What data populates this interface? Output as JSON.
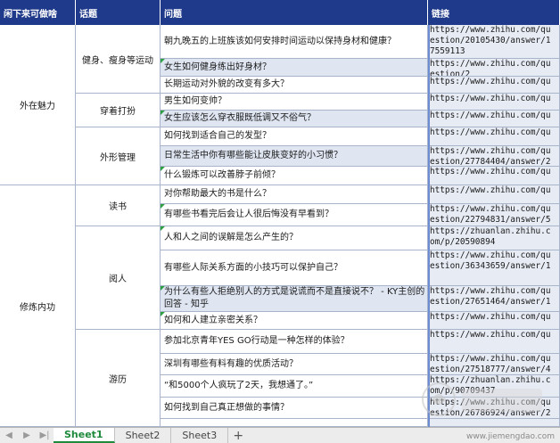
{
  "headers": [
    "闲下来可做啥",
    "话题",
    "问题",
    "链接"
  ],
  "categories": [
    "外在魅力",
    "修炼内功"
  ],
  "topics": [
    "健身、瘦身等运动",
    "穿着打扮",
    "外形管理",
    "读书",
    "阅人",
    "游历"
  ],
  "questions": [
    "朝九晚五的上班族该如何安排时间运动以保持身材和健康？",
    "女生如何健身练出好身材？",
    "长期运动对外貌的改变有多大？",
    "男生如何变帅？",
    "女生应该怎么穿衣服既低调又不俗气？",
    "如何找到适合自己的发型？",
    "日常生活中你有哪些能让皮肤变好的小习惯？",
    "什么锻炼可以改善脖子前倾？",
    "对你帮助最大的书是什么？",
    "有哪些书看完后会让人很后悔没有早看到？",
    "人和人之间的误解是怎么产生的？",
    "有哪些人际关系方面的小技巧可以保护自己？",
    "为什么有些人拒绝别人的方式是说谎而不是直接说不？ - KY主创的回答 - 知乎",
    "如何和人建立亲密关系？",
    "参加北京青年YES GO行动是一种怎样的体验？",
    "深圳有哪些有料有趣的优质活动？",
    "“和5000个人疯玩了2天，我想通了。”",
    "如何找到自己真正想做的事情？"
  ],
  "links": [
    [
      "https://www.zhihu.com/qu",
      "estion/20105430/answer/1",
      "7559113"
    ],
    [
      "https://www.zhihu.com/qu",
      "estion/2"
    ],
    [
      "https://www.zhihu.com/qu"
    ],
    [
      "https://www.zhihu.com/qu"
    ],
    [
      "https://www.zhihu.com/qu"
    ],
    [
      "https://www.zhihu.com/qu"
    ],
    [
      "https://www.zhihu.com/qu",
      "estion/27784404/answer/2"
    ],
    [
      "https://www.zhihu.com/qu"
    ],
    [
      "https://www.zhihu.com/qu"
    ],
    [
      "https://www.zhihu.com/qu",
      "estion/22794831/answer/5"
    ],
    [
      "https://zhuanlan.zhihu.c",
      "om/p/20590894"
    ],
    [
      "https://www.zhihu.com/qu",
      "estion/36343659/answer/1"
    ],
    [
      "https://www.zhihu.com/qu",
      "estion/27651464/answer/1"
    ],
    [
      "https://www.zhihu.com/qu"
    ],
    [
      "https://www.zhihu.com/qu"
    ],
    [
      "https://www.zhihu.com/qu",
      "estion/27518777/answer/4"
    ],
    [
      "https://zhuanlan.zhihu.c",
      "om/p/90709437"
    ],
    [
      "https://www.zhihu.com/qu",
      "estion/26786924/answer/2"
    ]
  ],
  "sheet_tabs": [
    "Sheet1",
    "Sheet2",
    "Sheet3"
  ],
  "add_tab_symbol": "+",
  "watermark": "www.jiemengdao.com",
  "colors": {
    "header_bg": "#1f3a8a",
    "row_alt": "#dfe6f2",
    "active_tab": "#1e8a3c",
    "grid": "#a7b4c9"
  }
}
